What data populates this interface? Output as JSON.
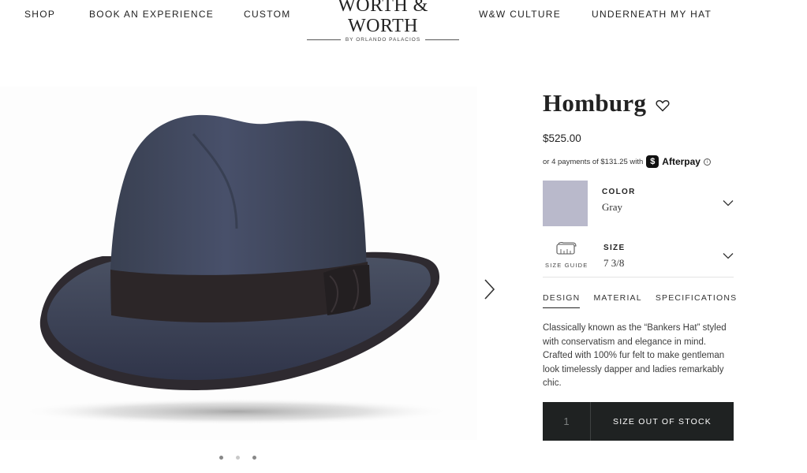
{
  "nav": {
    "left": [
      {
        "label": "SHOP"
      },
      {
        "label": "BOOK AN EXPERIENCE"
      },
      {
        "label": "CUSTOM"
      }
    ],
    "right": [
      {
        "label": "W&W CULTURE"
      },
      {
        "label": "UNDERNEATH MY HAT"
      }
    ],
    "logo": {
      "main": "WORTH & WORTH",
      "sub": "BY ORLANDO PALACIOS"
    }
  },
  "gallery": {
    "image_name": "gray-homburg-hat",
    "active_slide": 2,
    "total_slides": 3,
    "next_icon": "chevron-right-icon"
  },
  "product": {
    "title": "Homburg",
    "price": "$525.00",
    "afterpay": {
      "prefix": "or 4 payments of $131.25 with",
      "brand": "Afterpay",
      "info": "ⓘ"
    },
    "color": {
      "label": "COLOR",
      "value": "Gray",
      "swatch_hex": "#b9b9cb"
    },
    "size": {
      "label": "SIZE",
      "value": "7 3/8",
      "guide_label": "SIZE GUIDE"
    },
    "tabs": [
      {
        "label": "DESIGN",
        "active": true
      },
      {
        "label": "MATERIAL",
        "active": false
      },
      {
        "label": "SPECIFICATIONS",
        "active": false
      }
    ],
    "description": "Classically known as the “Bankers Hat” styled with conservatism and elegance in mind. Crafted with 100% fur felt to make gentleman look timelessly dapper and ladies remarkably chic.",
    "quantity": "1",
    "cta": "SIZE OUT OF STOCK"
  },
  "colors": {
    "text": "#222222",
    "button_bg": "#1f2222",
    "hat_felt": "#3f4554",
    "hat_band": "#2c2628"
  }
}
